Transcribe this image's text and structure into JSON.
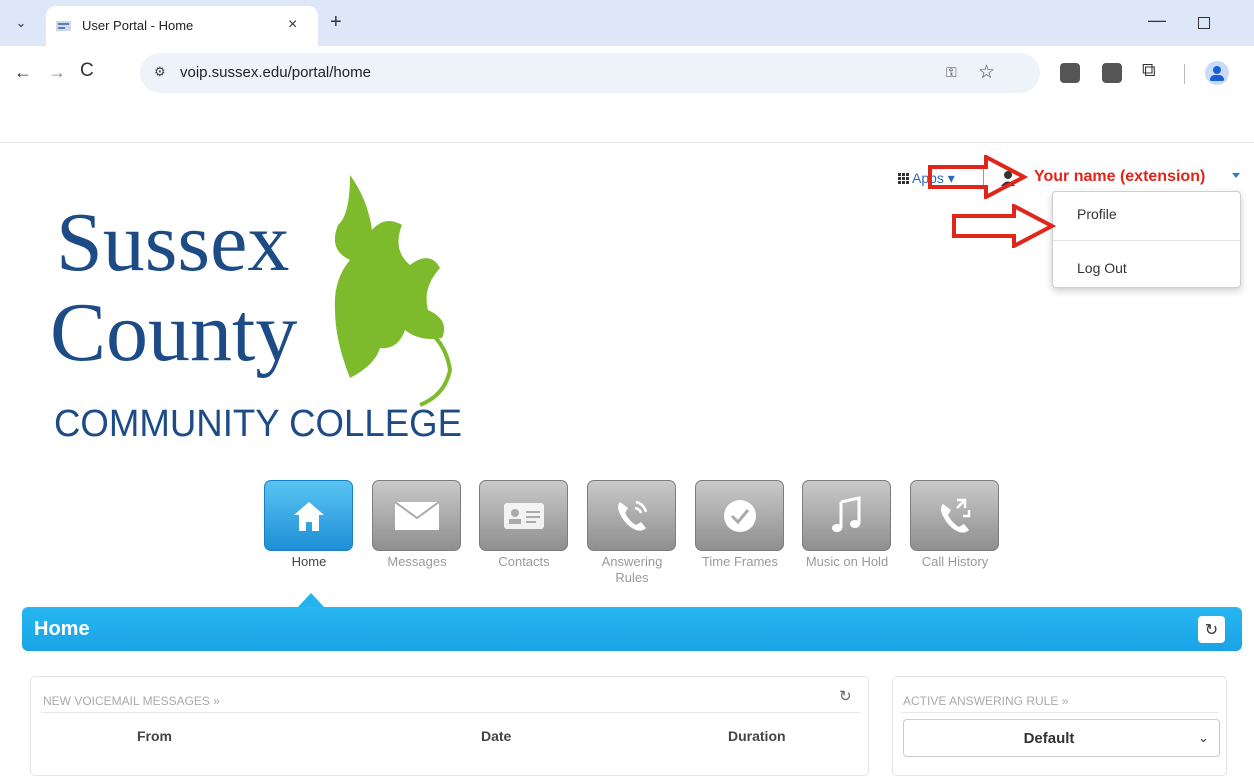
{
  "browser": {
    "tab_title": "User Portal - Home",
    "tab_close": "×",
    "new_tab": "+",
    "url": "voip.sussex.edu/portal/home",
    "minimize": "—",
    "nav_back": "←",
    "nav_forward": "→",
    "nav_reload": "C"
  },
  "header": {
    "apps_label": "Apps",
    "user_label": "Your name (extension)",
    "menu": {
      "profile": "Profile",
      "logout": "Log Out"
    }
  },
  "logo": {
    "line1": "Sussex",
    "line2": "County",
    "line3": "COMMUNITY COLLEGE"
  },
  "nav_icons": [
    {
      "label": "Home",
      "icon": "home-icon",
      "active": true
    },
    {
      "label": "Messages",
      "icon": "envelope-icon",
      "active": false
    },
    {
      "label": "Contacts",
      "icon": "contact-card-icon",
      "active": false
    },
    {
      "label": "Answering Rules",
      "icon": "phone-ringing-icon",
      "active": false
    },
    {
      "label": "Time Frames",
      "icon": "clock-icon",
      "active": false
    },
    {
      "label": "Music on Hold",
      "icon": "music-note-icon",
      "active": false
    },
    {
      "label": "Call History",
      "icon": "phone-arrows-icon",
      "active": false
    }
  ],
  "home_bar": {
    "title": "Home"
  },
  "voicemail_panel": {
    "title": "NEW VOICEMAIL MESSAGES »",
    "columns": [
      "From",
      "Date",
      "Duration"
    ]
  },
  "answering_panel": {
    "title": "ACTIVE ANSWERING RULE »",
    "selected": "Default"
  },
  "colors": {
    "accent_blue": "#1aa3e6",
    "annotation_red": "#e0251b",
    "logo_navy": "#1d4b86",
    "logo_green": "#7dbb2c"
  }
}
